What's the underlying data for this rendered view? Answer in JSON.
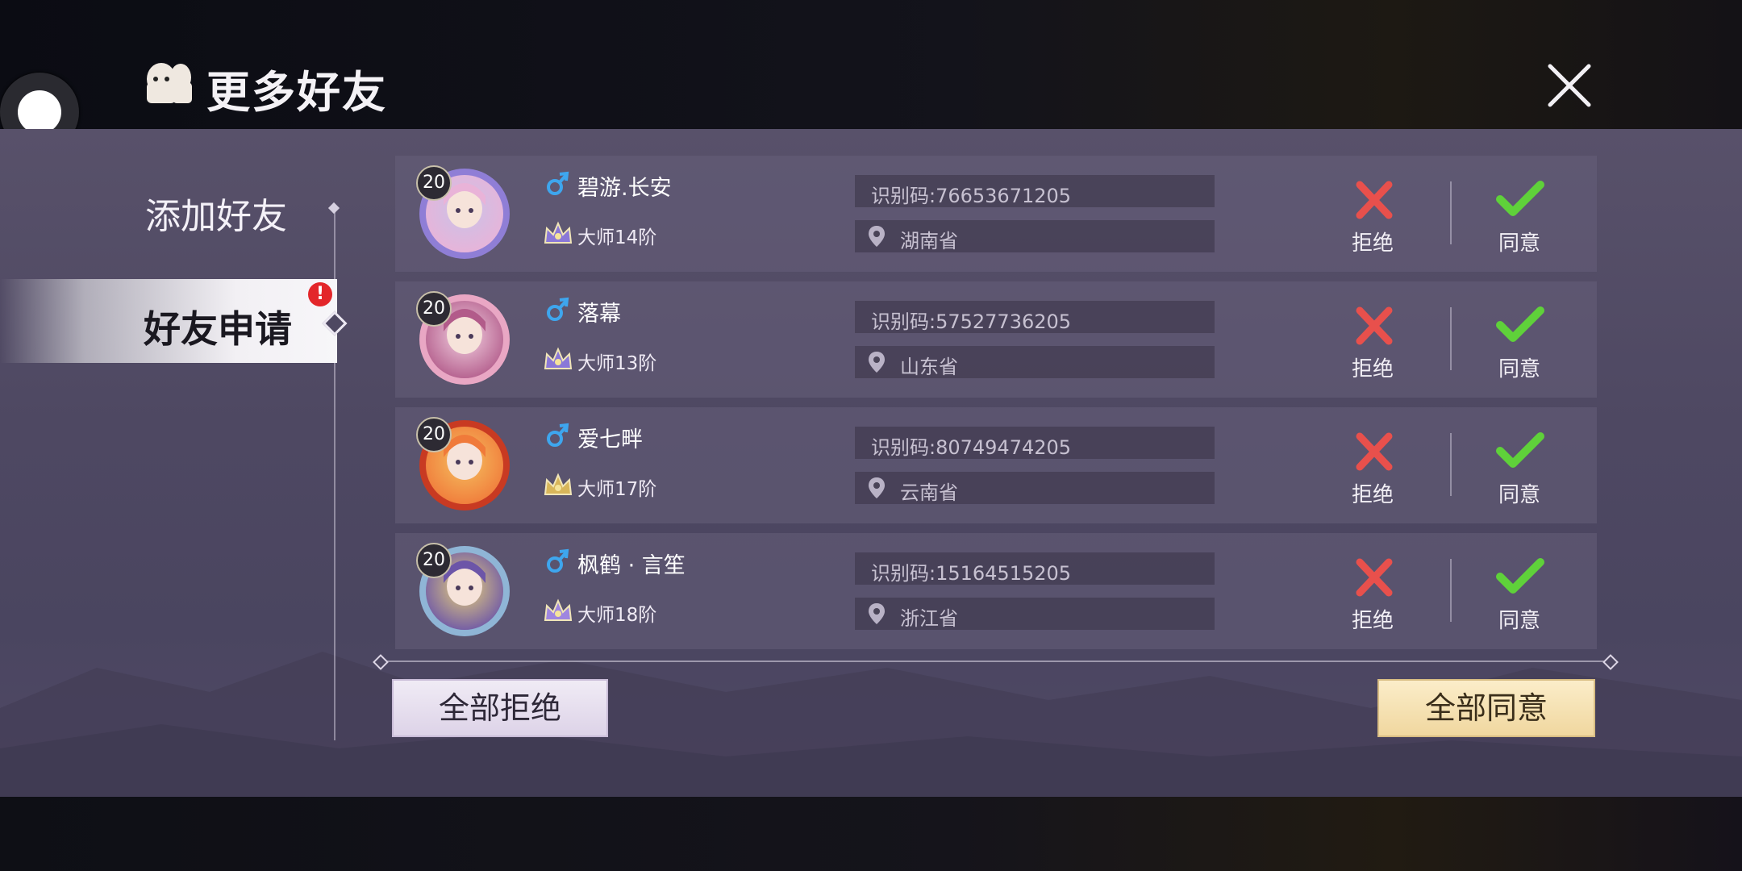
{
  "header": {
    "title": "更多好友"
  },
  "sidebar": {
    "items": [
      {
        "label": "添加好友",
        "selected": false
      },
      {
        "label": "好友申请",
        "selected": true,
        "badge": "!"
      }
    ]
  },
  "requests": [
    {
      "level": "20",
      "name": "碧游.长安",
      "rank": "大师14阶",
      "code": "识别码:76653671205",
      "location": "湖南省",
      "reject_label": "拒绝",
      "accept_label": "同意"
    },
    {
      "level": "20",
      "name": "落幕",
      "rank": "大师13阶",
      "code": "识别码:57527736205",
      "location": "山东省",
      "reject_label": "拒绝",
      "accept_label": "同意"
    },
    {
      "level": "20",
      "name": "爱七畔",
      "rank": "大师17阶",
      "code": "识别码:80749474205",
      "location": "云南省",
      "reject_label": "拒绝",
      "accept_label": "同意"
    },
    {
      "level": "20",
      "name": "枫鹤 · 言笙",
      "rank": "大师18阶",
      "code": "识别码:15164515205",
      "location": "浙江省",
      "reject_label": "拒绝",
      "accept_label": "同意"
    }
  ],
  "footer": {
    "reject_all_label": "全部拒绝",
    "accept_all_label": "全部同意"
  },
  "colors": {
    "reject": "#e8504c",
    "accept": "#5fd13a",
    "male": "#3ea6ee",
    "badge": "#e3262a"
  }
}
